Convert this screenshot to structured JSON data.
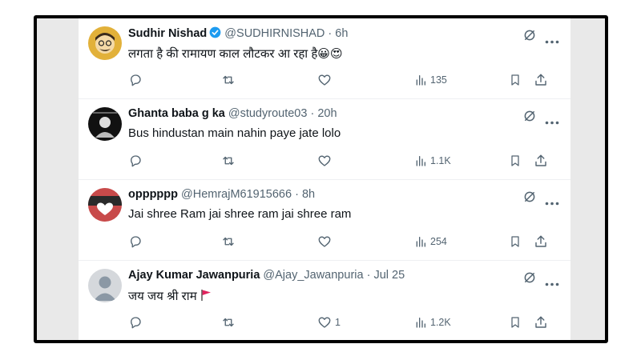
{
  "colors": {
    "name": "#0f1419",
    "meta": "#536471",
    "verified": "#1d9bf0",
    "divider": "#eef0f2",
    "frame": "#000000"
  },
  "icons": [
    "reply-icon",
    "retweet-icon",
    "like-icon",
    "views-icon",
    "bookmark-icon",
    "share-icon",
    "grok-icon",
    "more-icon",
    "verified-badge-icon"
  ],
  "tweets": [
    {
      "name": "Sudhir Nishad",
      "handle": "@SUDHIRNISHAD",
      "time": "· 6h",
      "text": "लगता है की रामायण काल लौटकर आ रहा है😀😍",
      "verified": true,
      "likes": "",
      "views": "135"
    },
    {
      "name": "Ghanta baba g ka",
      "handle": "@studyroute03",
      "time": "· 20h",
      "text": "Bus hindustan main nahin paye jate lolo",
      "verified": false,
      "likes": "",
      "views": "1.1K"
    },
    {
      "name": "opppppp",
      "handle": "@HemrajM61915666",
      "time": "· 8h",
      "text": "Jai shree Ram jai shree ram jai shree ram",
      "verified": false,
      "likes": "",
      "views": "254"
    },
    {
      "name": "Ajay Kumar Jawanpuria",
      "handle": "@Ajay_Jawanpuria",
      "time": "· Jul 25",
      "text": "जय जय श्री राम",
      "verified": false,
      "likes": "1",
      "views": "1.2K"
    }
  ]
}
